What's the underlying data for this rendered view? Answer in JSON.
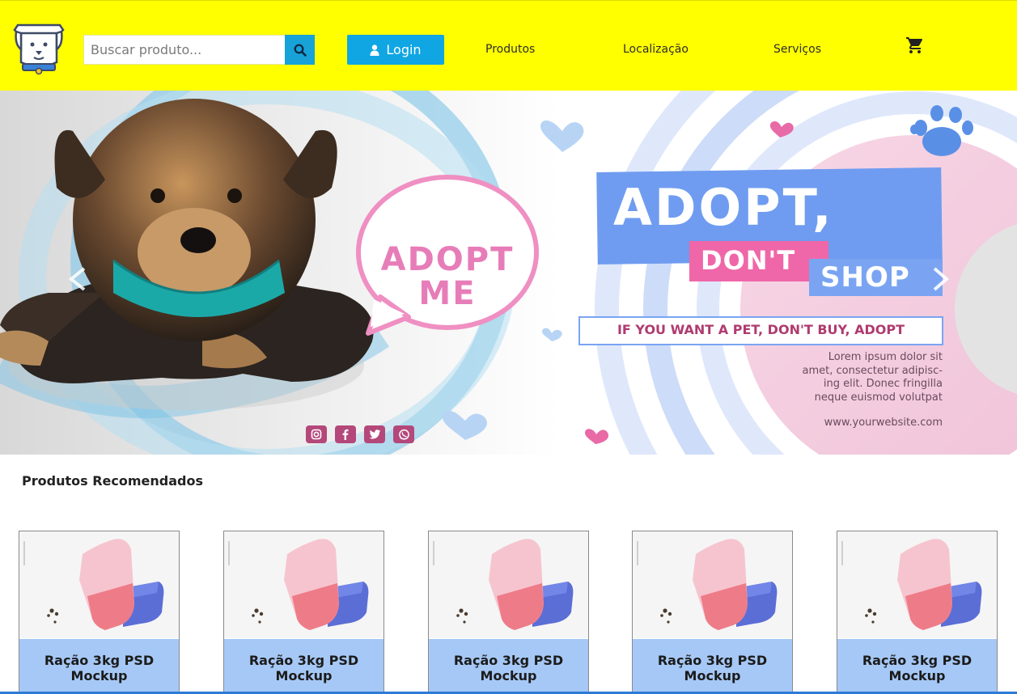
{
  "header": {
    "background_color": "#ffff00",
    "logo_icon": "dog-face-icon",
    "search": {
      "placeholder": "Buscar produto...",
      "value": "",
      "button_icon": "search-icon"
    },
    "login": {
      "label": "Login",
      "icon": "user-icon"
    },
    "nav": [
      {
        "label": "Produtos"
      },
      {
        "label": "Localização"
      },
      {
        "label": "Serviços"
      }
    ],
    "cart_icon": "shopping-cart-icon"
  },
  "banner": {
    "bubble_line1": "ADOPT",
    "bubble_line2": "ME",
    "headline": "ADOPT,",
    "headline2": "DON'T",
    "headline3": "SHOP",
    "tagline": "IF YOU WANT A PET, DON'T BUY, ADOPT",
    "body_lines": [
      "Lorem ipsum dolor sit",
      "amet, consectetur adipisc-",
      "ing elit. Donec fringilla",
      "neque euismod volutpat"
    ],
    "website": "www.yourwebsite.com",
    "social_icons": [
      "instagram-icon",
      "facebook-icon",
      "twitter-icon",
      "whatsapp-icon"
    ],
    "prev_icon": "chevron-left-icon",
    "next_icon": "chevron-right-icon"
  },
  "products": {
    "title": "Produtos Recomendados",
    "items": [
      {
        "name_line1": "Ração 3kg PSD",
        "name_line2": "Mockup"
      },
      {
        "name_line1": "Ração 3kg PSD",
        "name_line2": "Mockup"
      },
      {
        "name_line1": "Ração 3kg PSD",
        "name_line2": "Mockup"
      },
      {
        "name_line1": "Ração 3kg PSD",
        "name_line2": "Mockup"
      },
      {
        "name_line1": "Ração 3kg PSD",
        "name_line2": "Mockup"
      }
    ]
  }
}
